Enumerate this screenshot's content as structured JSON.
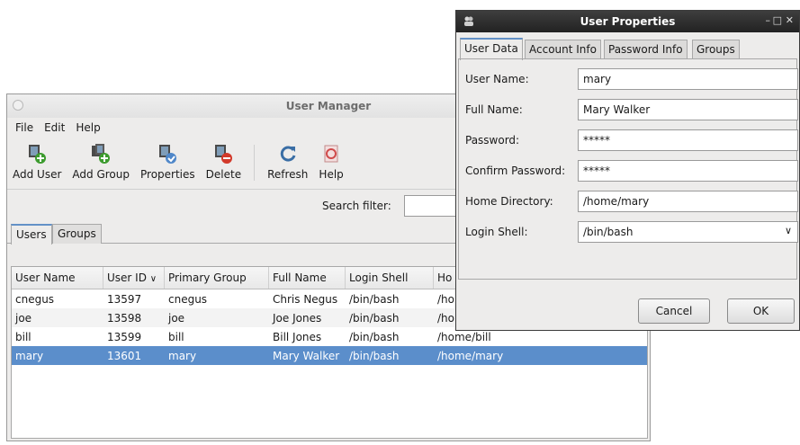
{
  "user_manager": {
    "title": "User Manager",
    "menu": [
      "File",
      "Edit",
      "Help"
    ],
    "toolbar": {
      "add_user": "Add User",
      "add_group": "Add Group",
      "properties": "Properties",
      "delete": "Delete",
      "refresh": "Refresh",
      "help": "Help"
    },
    "search_label": "Search filter:",
    "search_value": "",
    "tabs": [
      "Users",
      "Groups"
    ],
    "columns": [
      "User Name",
      "User ID",
      "Primary Group",
      "Full Name",
      "Login Shell",
      "Ho"
    ],
    "rows": [
      {
        "name": "cnegus",
        "id": "13597",
        "group": "cnegus",
        "full": "Chris Negus",
        "shell": "/bin/bash",
        "home": "/ho"
      },
      {
        "name": "joe",
        "id": "13598",
        "group": "joe",
        "full": "Joe Jones",
        "shell": "/bin/bash",
        "home": "/ho"
      },
      {
        "name": "bill",
        "id": "13599",
        "group": "bill",
        "full": "Bill Jones",
        "shell": "/bin/bash",
        "home": "/home/bill"
      },
      {
        "name": "mary",
        "id": "13601",
        "group": "mary",
        "full": "Mary Walker",
        "shell": "/bin/bash",
        "home": "/home/mary"
      }
    ],
    "selected_row": "mary"
  },
  "user_properties": {
    "title": "User Properties",
    "tabs": [
      "User Data",
      "Account Info",
      "Password Info",
      "Groups"
    ],
    "fields": {
      "user_name": {
        "label": "User Name:",
        "value": "mary"
      },
      "full_name": {
        "label": "Full Name:",
        "value": "Mary Walker"
      },
      "password": {
        "label": "Password:",
        "value": "*****"
      },
      "confirm_password": {
        "label": "Confirm Password:",
        "value": "*****"
      },
      "home_directory": {
        "label": "Home Directory:",
        "value": "/home/mary"
      },
      "login_shell": {
        "label": "Login Shell:",
        "value": "/bin/bash"
      }
    },
    "buttons": {
      "cancel": "Cancel",
      "ok": "OK"
    }
  },
  "colors": {
    "selection": "#5b8ecb",
    "tab_accent": "#6391c7",
    "dialog_titlebar": "#2b2b2b"
  }
}
